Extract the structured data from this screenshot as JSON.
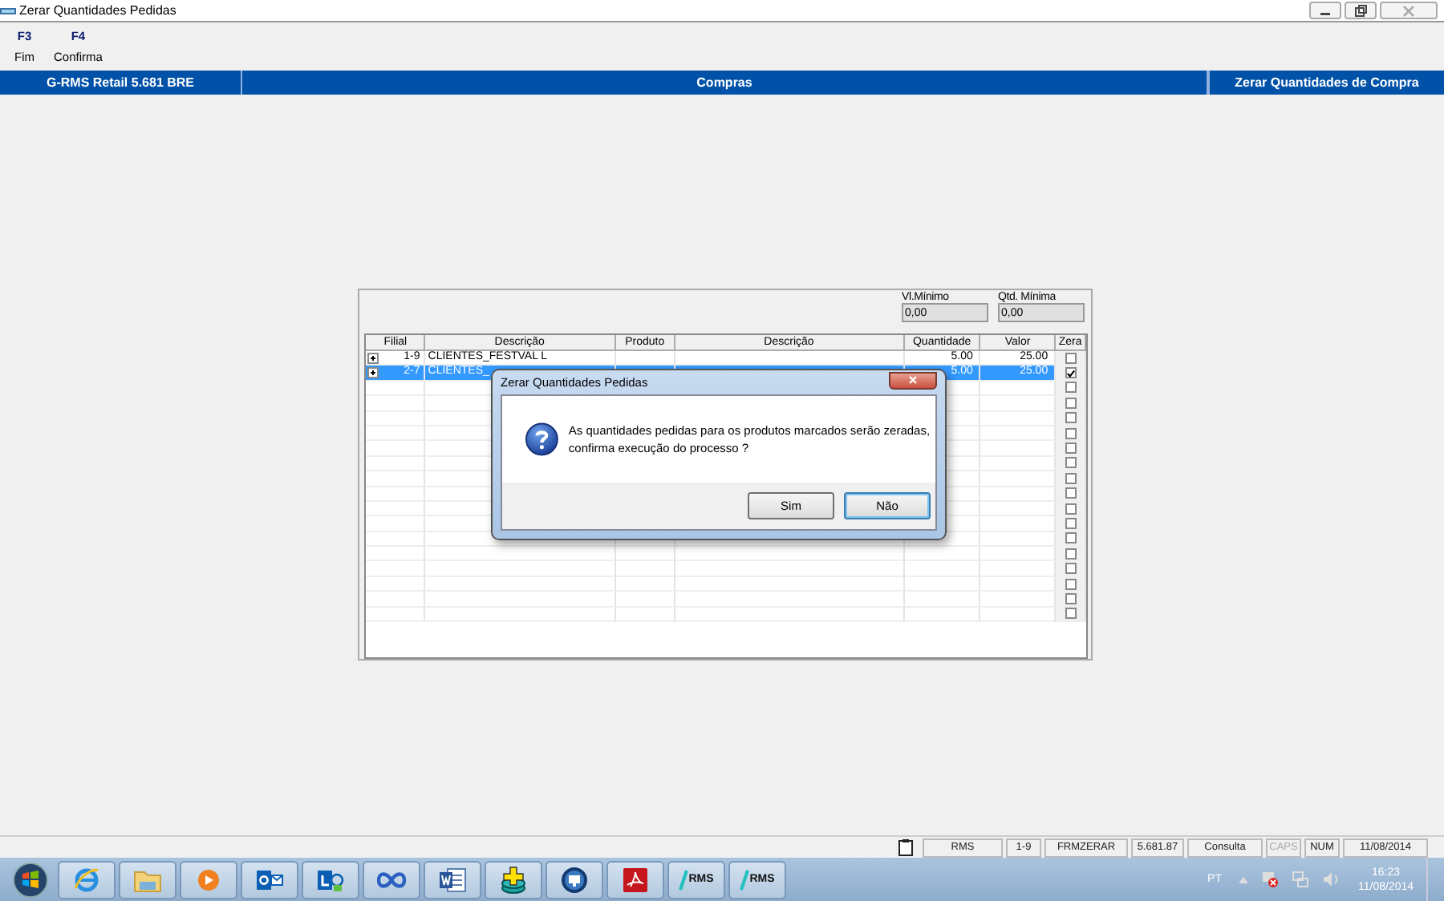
{
  "window": {
    "title": "Zerar Quantidades Pedidas"
  },
  "toolbar": [
    {
      "key": "F3",
      "label": "Fim"
    },
    {
      "key": "F4",
      "label": "Confirma"
    }
  ],
  "header": {
    "app": "G-RMS Retail 5.681 BRE",
    "module": "Compras",
    "screen": "Zerar Quantidades de Compra"
  },
  "filters": [
    {
      "label": "Vl.Mínimo",
      "value": "0,00"
    },
    {
      "label": "Qtd. Mínima",
      "value": "0,00"
    }
  ],
  "table": {
    "columns": [
      "Filial",
      "Descrição",
      "Produto",
      "Descrição",
      "Quantidade",
      "Valor",
      "Zera"
    ],
    "rows": [
      {
        "expandable": true,
        "filial": "1-9",
        "descricao": "CLIENTES_FESTVAL L",
        "quantidade": "5.00",
        "valor": "25.00",
        "checked": false,
        "selected": false
      },
      {
        "expandable": true,
        "filial": "2-7",
        "descricao": "CLIENTES_",
        "quantidade": "5.00",
        "valor": "25.00",
        "checked": true,
        "selected": true
      },
      {
        "expandable": false,
        "checked": false,
        "selected": false
      },
      {
        "expandable": false,
        "checked": false,
        "selected": false
      },
      {
        "expandable": false,
        "checked": false,
        "selected": false
      },
      {
        "expandable": false,
        "checked": false,
        "selected": false
      },
      {
        "expandable": false,
        "checked": false,
        "selected": false
      },
      {
        "expandable": false,
        "checked": false,
        "selected": false
      },
      {
        "expandable": false,
        "checked": false,
        "selected": false
      },
      {
        "expandable": false,
        "checked": false,
        "selected": false
      },
      {
        "expandable": false,
        "checked": false,
        "selected": false
      },
      {
        "expandable": false,
        "checked": false,
        "selected": false
      },
      {
        "expandable": false,
        "checked": false,
        "selected": false
      },
      {
        "expandable": false,
        "checked": false,
        "selected": false
      },
      {
        "expandable": false,
        "checked": false,
        "selected": false
      },
      {
        "expandable": false,
        "checked": false,
        "selected": false
      },
      {
        "expandable": false,
        "checked": false,
        "selected": false
      },
      {
        "expandable": false,
        "checked": false,
        "selected": false
      }
    ]
  },
  "dialog": {
    "title": "Zerar Quantidades Pedidas",
    "message": "As quantidades pedidas para os produtos marcados serão zeradas, confirma execução do processo ?",
    "buttons": [
      "Sim",
      "Não"
    ]
  },
  "status_bar": [
    {
      "text": "RMS",
      "on": true
    },
    {
      "text": "1-9",
      "on": true
    },
    {
      "text": "FRMZERAR",
      "on": true
    },
    {
      "text": "5.681.87",
      "on": true
    },
    {
      "text": "Consulta",
      "on": true
    },
    {
      "text": "CAPS",
      "on": false
    },
    {
      "text": "NUM",
      "on": true
    },
    {
      "text": "11/08/2014",
      "on": true
    }
  ],
  "taskbar": {
    "apps": [
      {
        "label": "RMS"
      },
      {
        "label": "RMS"
      }
    ],
    "language": "PT",
    "time": "16:23",
    "date": "11/08/2014"
  }
}
